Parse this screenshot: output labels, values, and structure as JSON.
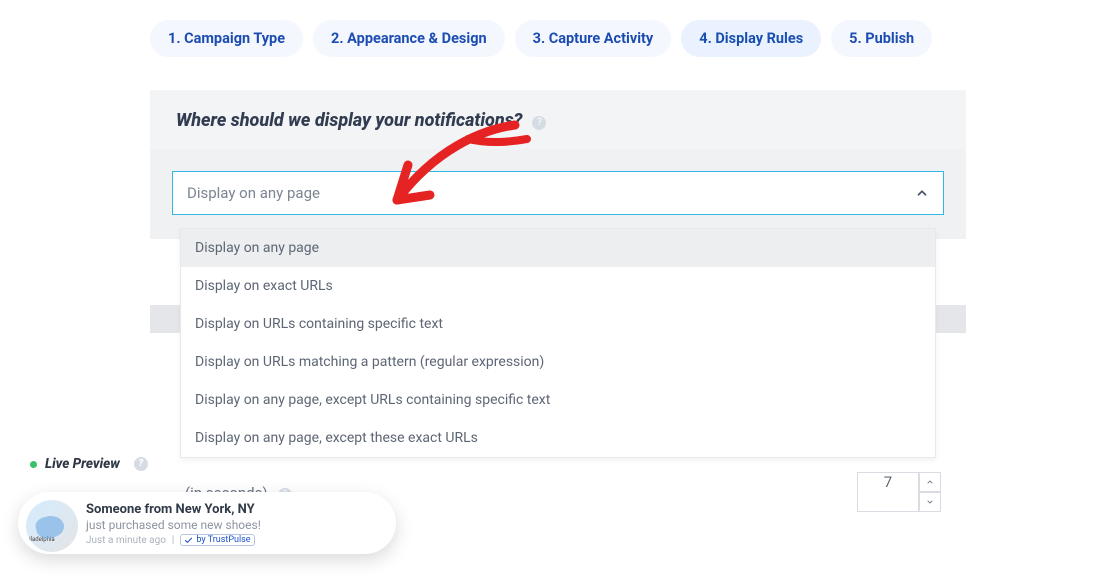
{
  "tabs": {
    "t1": "1. Campaign Type",
    "t2": "2. Appearance & Design",
    "t3": "3. Capture Activity",
    "t4": "4. Display Rules",
    "t5": "5. Publish"
  },
  "section": {
    "title": "Where should we display your notifications?"
  },
  "display_select": {
    "placeholder": "Display on any page",
    "options": {
      "o0": "Display on any page",
      "o1": "Display on exact URLs",
      "o2": "Display on URLs containing specific text",
      "o3": "Display on URLs matching a pattern (regular expression)",
      "o4": "Display on any page, except URLs containing specific text",
      "o5": "Display on any page, except these exact URLs"
    }
  },
  "delay_row": {
    "label_fragment": "(in seconds)",
    "value": "7"
  },
  "live_preview": {
    "label": "Live Preview",
    "title": "Someone from New York, NY",
    "subtitle": "just purchased some new shoes!",
    "time": "Just a minute ago",
    "brand": "by TrustPulse"
  }
}
